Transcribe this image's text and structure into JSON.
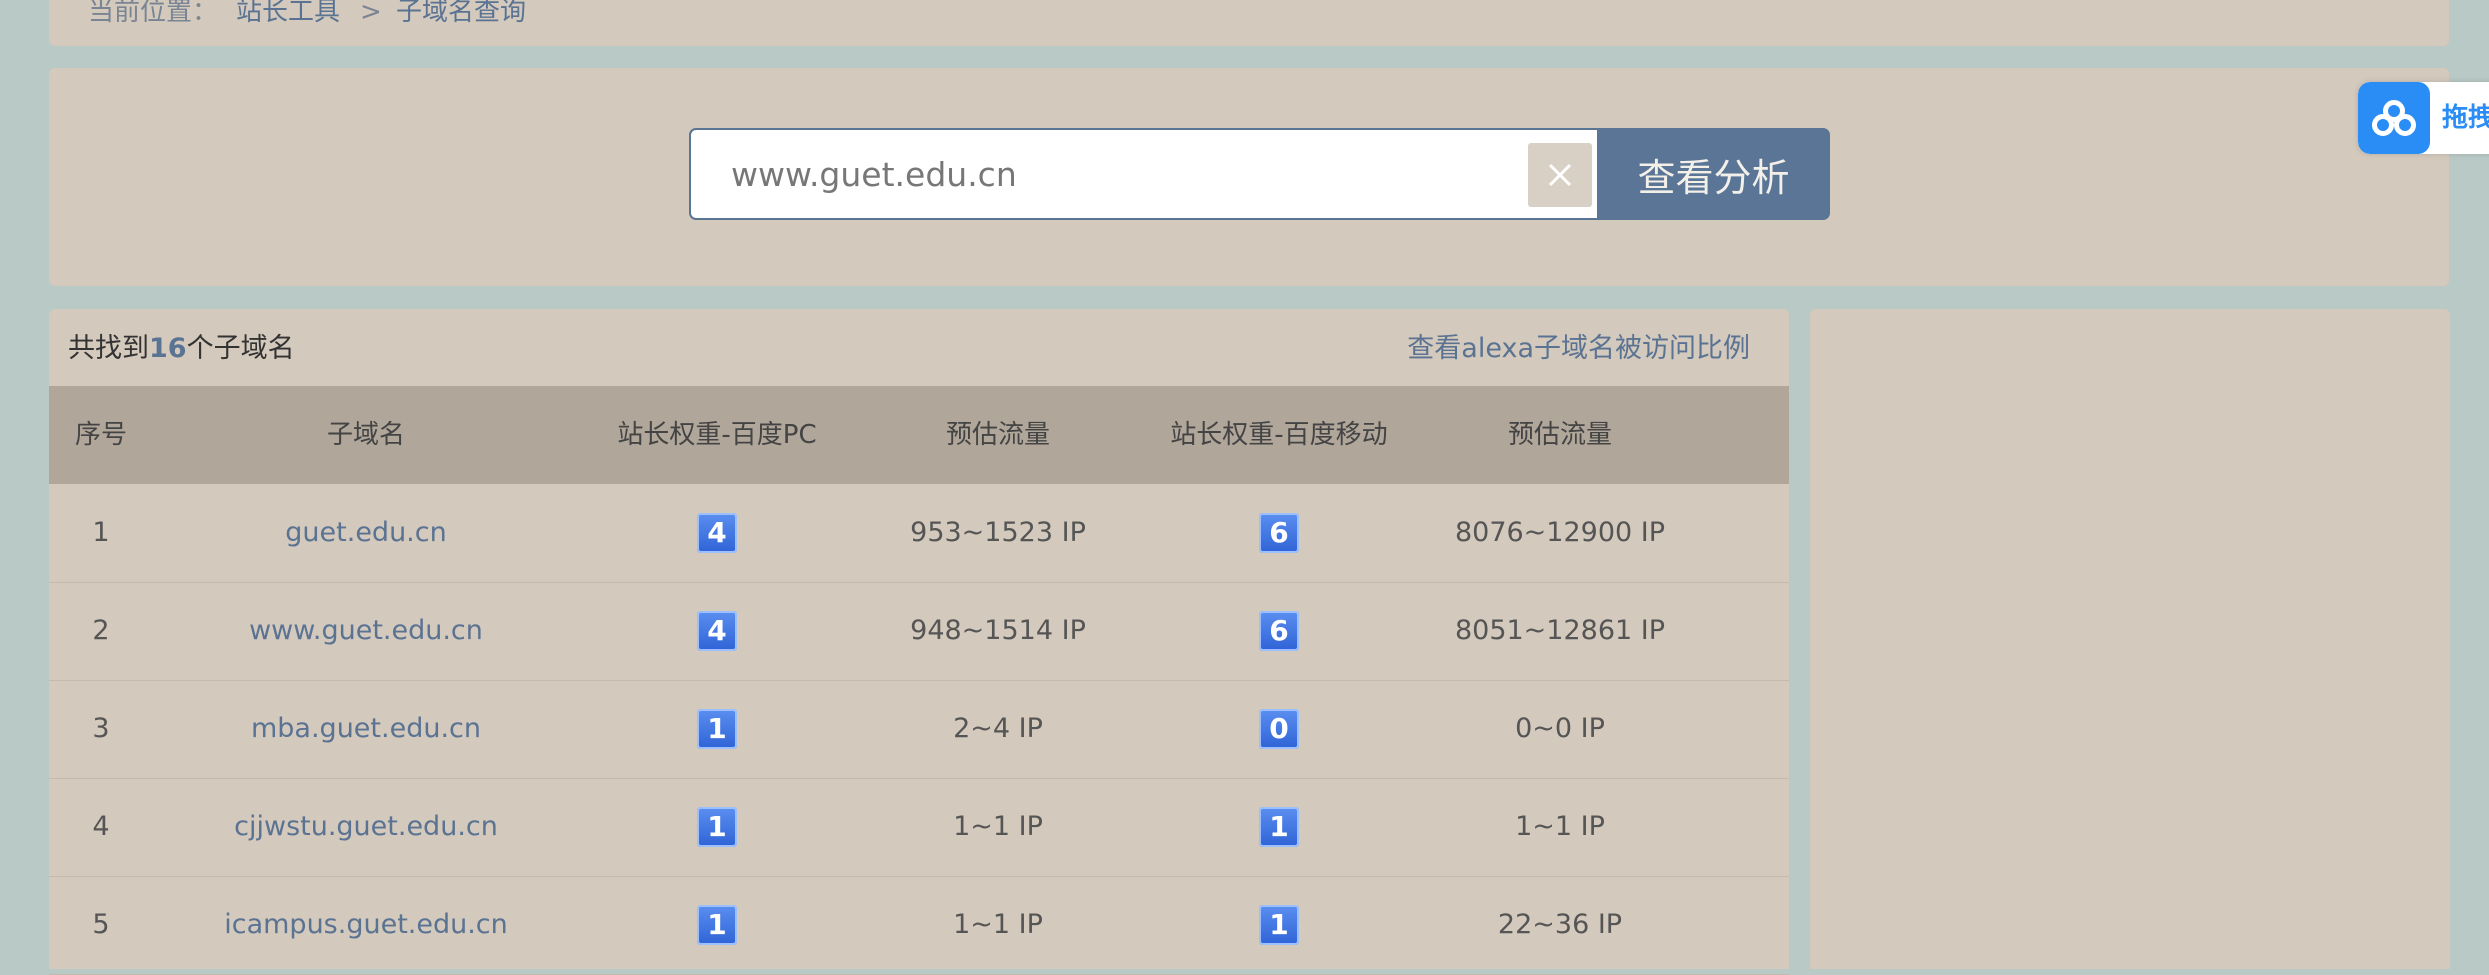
{
  "breadcrumb": {
    "prefix": "当前位置：",
    "home": "站长工具",
    "separator": ">",
    "current": "子域名查询"
  },
  "search": {
    "value": "www.guet.edu.cn",
    "submit_label": "查看分析"
  },
  "summary": {
    "before": "共找到",
    "count": "16",
    "after": "个子域名",
    "alexa_link": "查看alexa子域名被访问比例"
  },
  "table": {
    "headers": [
      "序号",
      "子域名",
      "站长权重-百度PC",
      "预估流量",
      "站长权重-百度移动",
      "预估流量"
    ],
    "rows": [
      {
        "index": "1",
        "domain": "guet.edu.cn",
        "pc_rank": "4",
        "pc_traffic": "953~1523 IP",
        "mobile_rank": "6",
        "mobile_traffic": "8076~12900 IP"
      },
      {
        "index": "2",
        "domain": "www.guet.edu.cn",
        "pc_rank": "4",
        "pc_traffic": "948~1514 IP",
        "mobile_rank": "6",
        "mobile_traffic": "8051~12861 IP"
      },
      {
        "index": "3",
        "domain": "mba.guet.edu.cn",
        "pc_rank": "1",
        "pc_traffic": "2~4 IP",
        "mobile_rank": "0",
        "mobile_traffic": "0~0 IP"
      },
      {
        "index": "4",
        "domain": "cjjwstu.guet.edu.cn",
        "pc_rank": "1",
        "pc_traffic": "1~1 IP",
        "mobile_rank": "1",
        "mobile_traffic": "1~1 IP"
      },
      {
        "index": "5",
        "domain": "icampus.guet.edu.cn",
        "pc_rank": "1",
        "pc_traffic": "1~1 IP",
        "mobile_rank": "1",
        "mobile_traffic": "22~36 IP"
      }
    ]
  },
  "float_widget": {
    "label": "拖拽",
    "icon": "baidu-netdisk-icon"
  },
  "colors": {
    "page_bg": "#b9c9c6",
    "panel_bg": "#d3c9bc",
    "header_bg": "#b0a69a",
    "accent": "#5a7595",
    "link": "#5b7393",
    "badge": "#3a6fe0"
  }
}
